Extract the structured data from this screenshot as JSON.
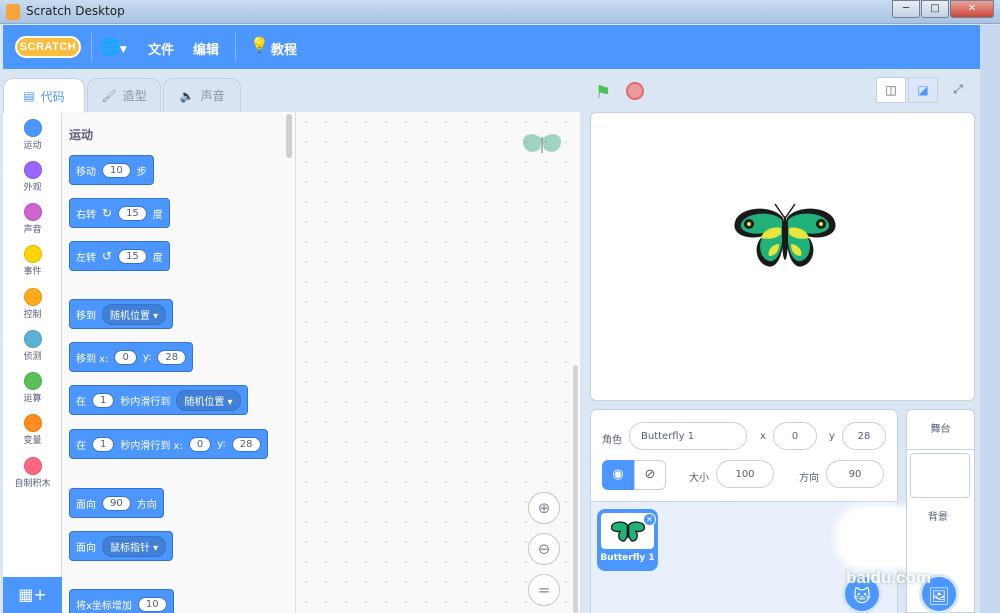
{
  "window": {
    "title": "Scratch Desktop"
  },
  "menu": {
    "logo": "SCRATCH",
    "file": "文件",
    "edit": "编辑",
    "tutorials": "教程"
  },
  "tabs": [
    {
      "label": "代码",
      "active": true
    },
    {
      "label": "造型",
      "active": false
    },
    {
      "label": "声音",
      "active": false
    }
  ],
  "categories": [
    {
      "label": "运动",
      "color": "#4c97ff"
    },
    {
      "label": "外观",
      "color": "#9966ff"
    },
    {
      "label": "声音",
      "color": "#cf63cf"
    },
    {
      "label": "事件",
      "color": "#ffd500"
    },
    {
      "label": "控制",
      "color": "#ffab19"
    },
    {
      "label": "侦测",
      "color": "#5cb1d6"
    },
    {
      "label": "运算",
      "color": "#59c059"
    },
    {
      "label": "变量",
      "color": "#ff8c1a"
    },
    {
      "label": "自制积木",
      "color": "#ff6680"
    }
  ],
  "palette": {
    "heading": "运动",
    "blocks": {
      "move": {
        "t1": "移动",
        "v1": "10",
        "t2": "步"
      },
      "turn_right": {
        "t1": "右转",
        "v1": "15",
        "t2": "度"
      },
      "turn_left": {
        "t1": "左转",
        "v1": "15",
        "t2": "度"
      },
      "goto": {
        "t1": "移到",
        "dd": "随机位置"
      },
      "goto_xy": {
        "t1": "移到 x:",
        "x": "0",
        "t2": "y:",
        "y": "28"
      },
      "glide": {
        "t1": "在",
        "v1": "1",
        "t2": "秒内滑行到",
        "dd": "随机位置"
      },
      "glide_xy": {
        "t1": "在",
        "v1": "1",
        "t2": "秒内滑行到 x:",
        "x": "0",
        "t3": "y:",
        "y": "28"
      },
      "point": {
        "t1": "面向",
        "v1": "90",
        "t2": "方向"
      },
      "point_towards": {
        "t1": "面向",
        "dd": "鼠标指针"
      },
      "change_x": {
        "t1": "将x坐标增加",
        "v1": "10"
      }
    }
  },
  "sprite_info": {
    "sprite_label": "角色",
    "sprite_name": "Butterfly 1",
    "x_label": "x",
    "x": "0",
    "y_label": "y",
    "y": "28",
    "size_label": "大小",
    "size": "100",
    "direction_label": "方向",
    "direction": "90"
  },
  "sprites": [
    {
      "name": "Butterfly 1"
    }
  ],
  "stage_pane": {
    "header": "舞台",
    "backdrop_label": "背景"
  },
  "watermark": "baidu.com"
}
